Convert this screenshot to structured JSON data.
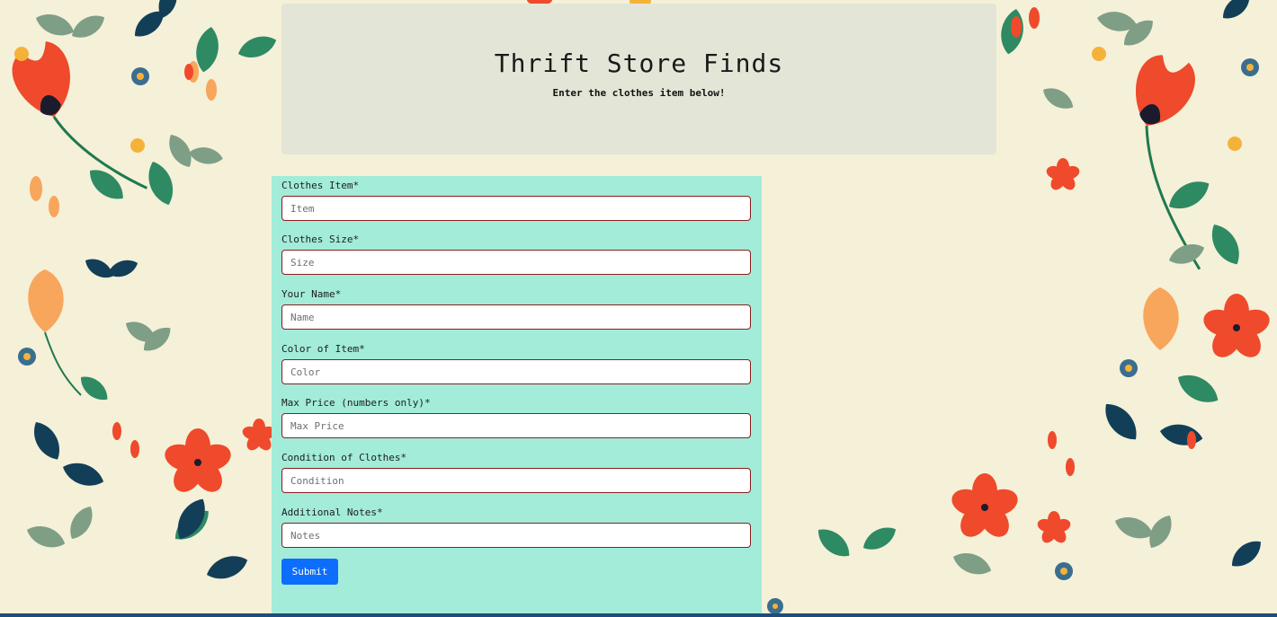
{
  "colors": {
    "page_bg": "#f5f0d8",
    "header_bg": "#e3e6d6",
    "form_bg": "#a2ecd9",
    "input_border": "#8b1d1d",
    "submit_bg": "#0d6efd"
  },
  "header": {
    "title": "Thrift Store Finds",
    "subtitle": "Enter the clothes item below!"
  },
  "form": {
    "fields": [
      {
        "label": "Clothes Item*",
        "placeholder": "Item",
        "value": ""
      },
      {
        "label": "Clothes Size*",
        "placeholder": "Size",
        "value": ""
      },
      {
        "label": "Your Name*",
        "placeholder": "Name",
        "value": ""
      },
      {
        "label": "Color of Item*",
        "placeholder": "Color",
        "value": ""
      },
      {
        "label": "Max Price (numbers only)*",
        "placeholder": "Max Price",
        "value": ""
      },
      {
        "label": "Condition of Clothes*",
        "placeholder": "Condition",
        "value": ""
      },
      {
        "label": "Additional Notes*",
        "placeholder": "Notes",
        "value": ""
      }
    ],
    "submit_label": "Submit"
  },
  "background": {
    "pattern": "floral-illustration",
    "icons": [
      "red-poppy-icon",
      "green-leaf-icon",
      "navy-leaf-icon",
      "blue-flower-icon",
      "orange-bud-icon",
      "orange-flower-icon"
    ]
  }
}
